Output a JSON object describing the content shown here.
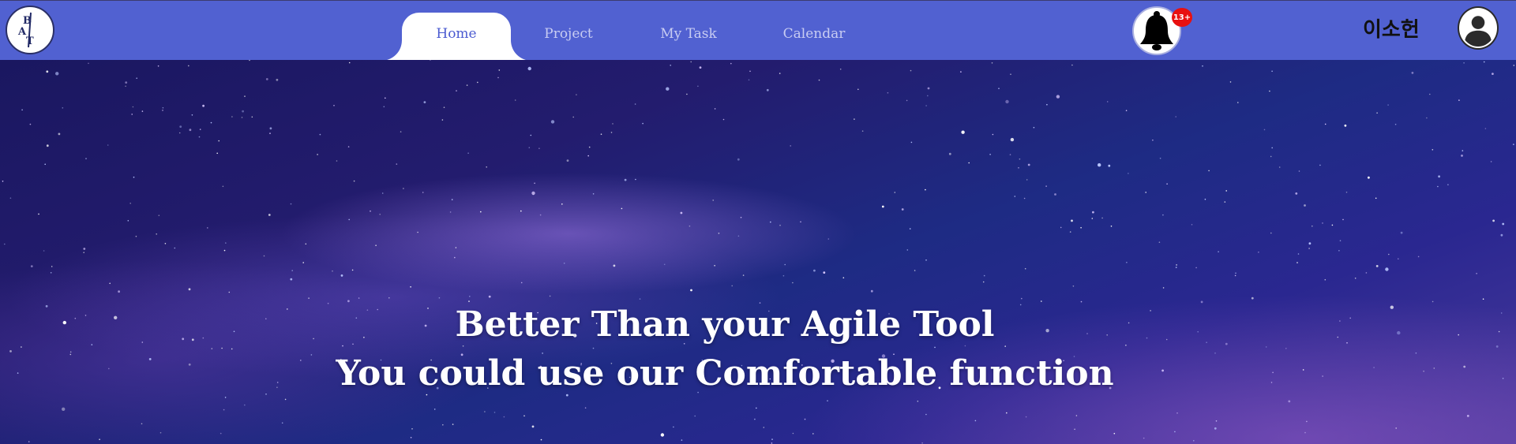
{
  "logo": {
    "letters": [
      "B",
      "A",
      "T"
    ]
  },
  "nav": {
    "tabs": [
      {
        "label": "Home",
        "active": true
      },
      {
        "label": "Project",
        "active": false
      },
      {
        "label": "My Task",
        "active": false
      },
      {
        "label": "Calendar",
        "active": false
      }
    ]
  },
  "notifications": {
    "badge": "13+",
    "icon": "bell-icon"
  },
  "user": {
    "name": "이소헌",
    "icon": "user-avatar-icon"
  },
  "hero": {
    "line1": "Better Than your Agile Tool",
    "line2": "You could use our Comfortable function"
  },
  "colors": {
    "navbar": "#5161d1",
    "active_tab_text": "#4a5ad0",
    "badge": "#e81010"
  }
}
